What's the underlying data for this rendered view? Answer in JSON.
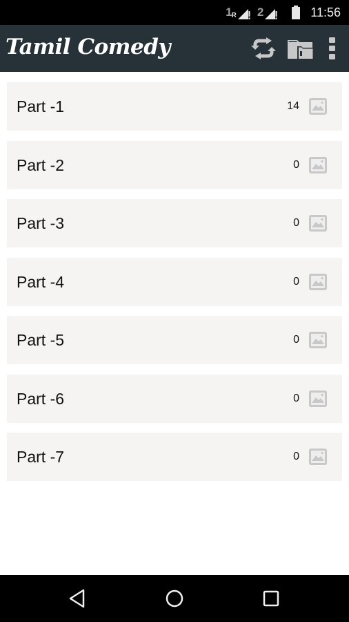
{
  "status_bar": {
    "sim1_label": "1",
    "sim1_roaming": "R",
    "sim2_label": "2",
    "time": "11:56"
  },
  "app_bar": {
    "title": "Tamil Comedy",
    "actions": [
      {
        "name": "refresh",
        "icon": "refresh-icon"
      },
      {
        "name": "folder",
        "icon": "folder-icon"
      },
      {
        "name": "overflow-menu",
        "icon": "more-vert-icon"
      }
    ]
  },
  "list": {
    "items": [
      {
        "label": "Part -1",
        "count": "14",
        "icon": "image-icon"
      },
      {
        "label": "Part -2",
        "count": "0",
        "icon": "image-icon"
      },
      {
        "label": "Part -3",
        "count": "0",
        "icon": "image-icon"
      },
      {
        "label": "Part -4",
        "count": "0",
        "icon": "image-icon"
      },
      {
        "label": "Part -5",
        "count": "0",
        "icon": "image-icon"
      },
      {
        "label": "Part -6",
        "count": "0",
        "icon": "image-icon"
      },
      {
        "label": "Part -7",
        "count": "0",
        "icon": "image-icon"
      }
    ]
  },
  "nav_bar": {
    "buttons": [
      {
        "name": "back",
        "icon": "back-triangle-icon"
      },
      {
        "name": "home",
        "icon": "home-circle-icon"
      },
      {
        "name": "recents",
        "icon": "recents-square-icon"
      }
    ]
  },
  "colors": {
    "app_bar_bg": "#263238",
    "row_bg": "#f5f4f2",
    "icon_gray": "#c8c8c8"
  }
}
